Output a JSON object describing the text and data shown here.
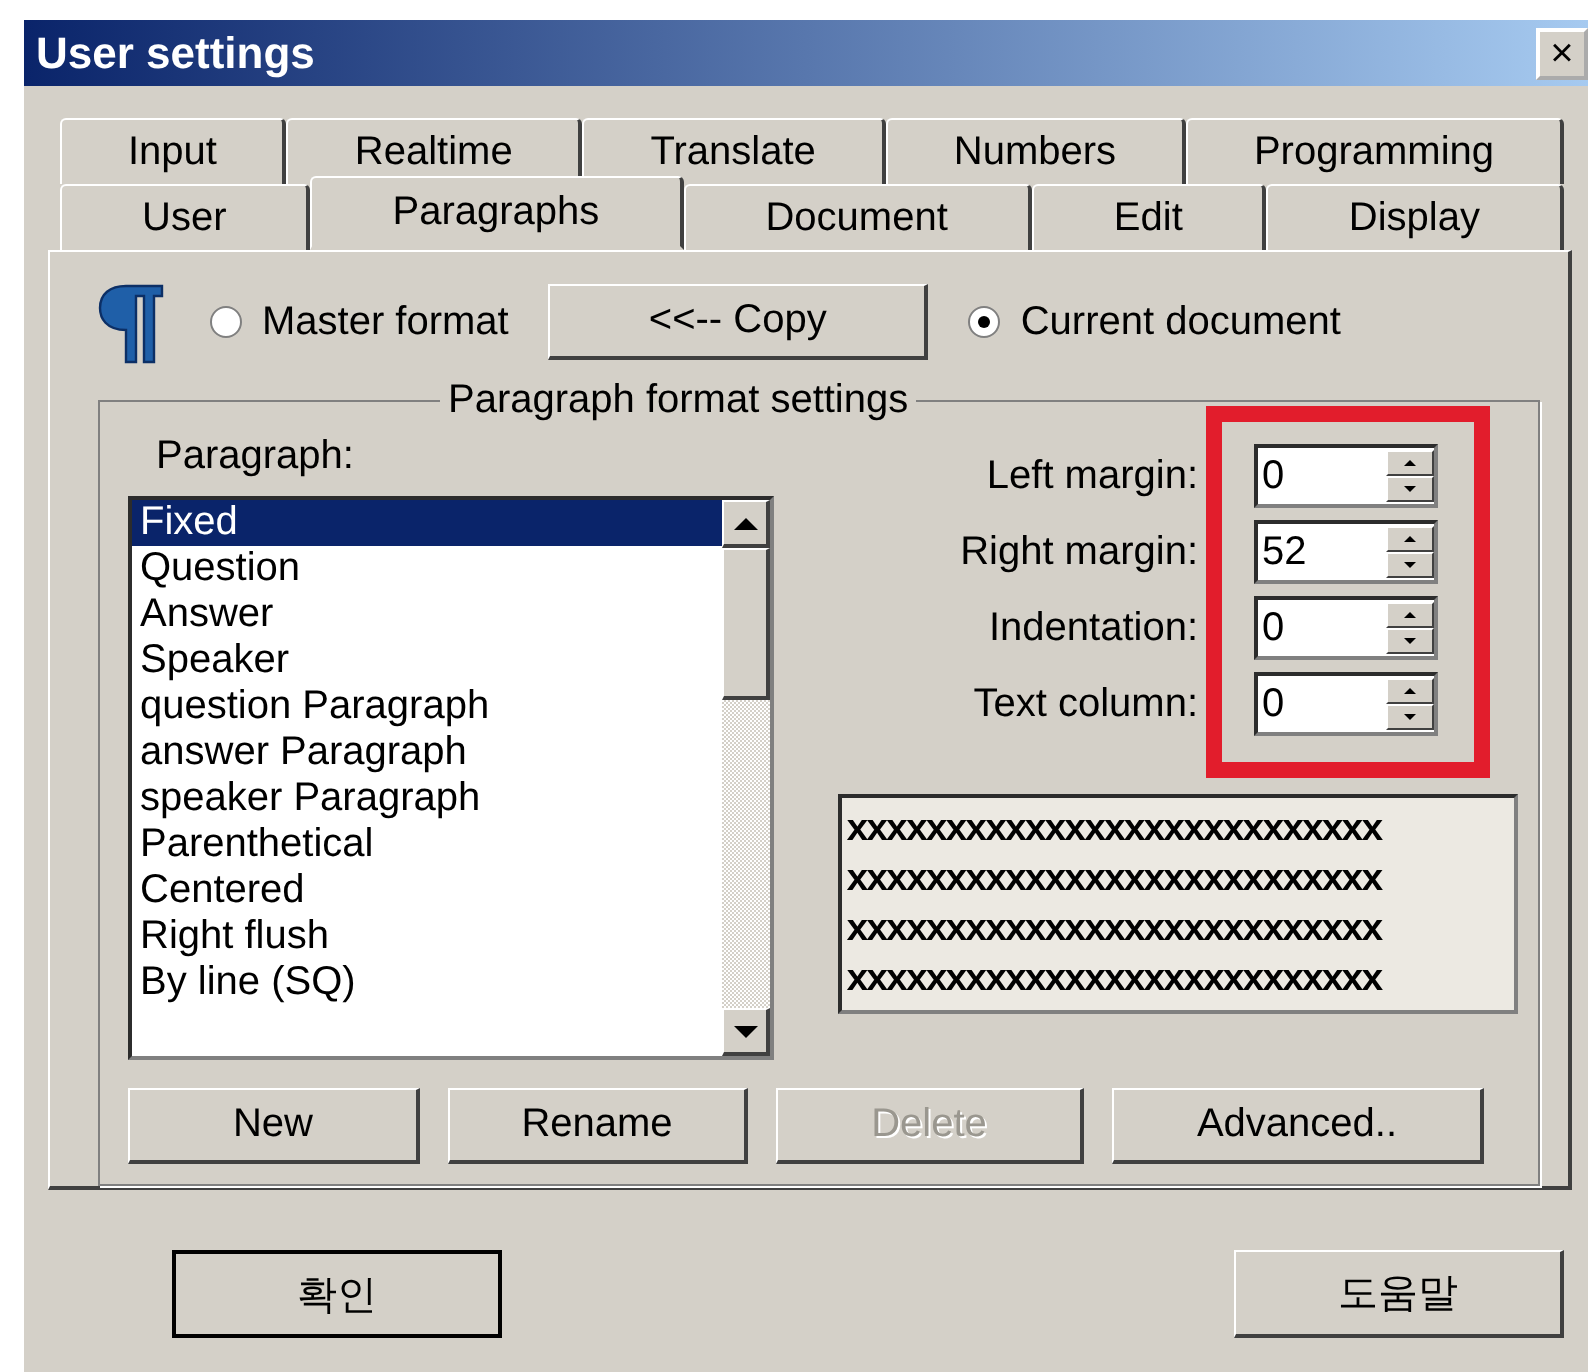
{
  "window": {
    "title": "User settings",
    "close": "×"
  },
  "tab_rows": [
    {
      "tabs": [
        {
          "label": "Input",
          "selected": false
        },
        {
          "label": "Realtime",
          "selected": false
        },
        {
          "label": "Translate",
          "selected": false
        },
        {
          "label": "Numbers",
          "selected": false
        },
        {
          "label": "Programming",
          "selected": false
        }
      ]
    },
    {
      "tabs": [
        {
          "label": "User",
          "selected": false
        },
        {
          "label": "Paragraphs",
          "selected": true
        },
        {
          "label": "Document",
          "selected": false
        },
        {
          "label": "Edit",
          "selected": false
        },
        {
          "label": "Display",
          "selected": false
        }
      ]
    }
  ],
  "format_source": {
    "options": [
      {
        "label": "Master format",
        "selected": false
      },
      {
        "label": "Current document",
        "selected": true
      }
    ],
    "copy_button": "<<-- Copy"
  },
  "group": {
    "title": "Paragraph format settings",
    "list_label": "Paragraph:",
    "items": [
      {
        "label": "Fixed",
        "selected": true
      },
      {
        "label": "Question",
        "selected": false
      },
      {
        "label": "Answer",
        "selected": false
      },
      {
        "label": "Speaker",
        "selected": false
      },
      {
        "label": "question Paragraph",
        "selected": false
      },
      {
        "label": "answer Paragraph",
        "selected": false
      },
      {
        "label": "speaker Paragraph",
        "selected": false
      },
      {
        "label": "Parenthetical",
        "selected": false
      },
      {
        "label": "Centered",
        "selected": false
      },
      {
        "label": "Right flush",
        "selected": false
      },
      {
        "label": "By line (SQ)",
        "selected": false
      }
    ],
    "fields": [
      {
        "label": "Left margin:",
        "value": "0"
      },
      {
        "label": "Right margin:",
        "value": "52"
      },
      {
        "label": "Indentation:",
        "value": "0"
      },
      {
        "label": "Text column:",
        "value": "0"
      }
    ],
    "preview_lines": [
      "xxxxxxxxxxxxxxxxxxxxxxxxxxx",
      "xxxxxxxxxxxxxxxxxxxxxxxxxxx",
      "xxxxxxxxxxxxxxxxxxxxxxxxxxx",
      "xxxxxxxxxxxxxxxxxxxxxxxxxxx"
    ],
    "buttons": [
      {
        "label": "New",
        "disabled": false
      },
      {
        "label": "Rename",
        "disabled": false
      },
      {
        "label": "Delete",
        "disabled": true
      },
      {
        "label": "Advanced..",
        "disabled": false
      }
    ]
  },
  "footer_buttons": [
    {
      "label": "확인",
      "default": true
    },
    {
      "label": "도움말",
      "default": false
    }
  ]
}
